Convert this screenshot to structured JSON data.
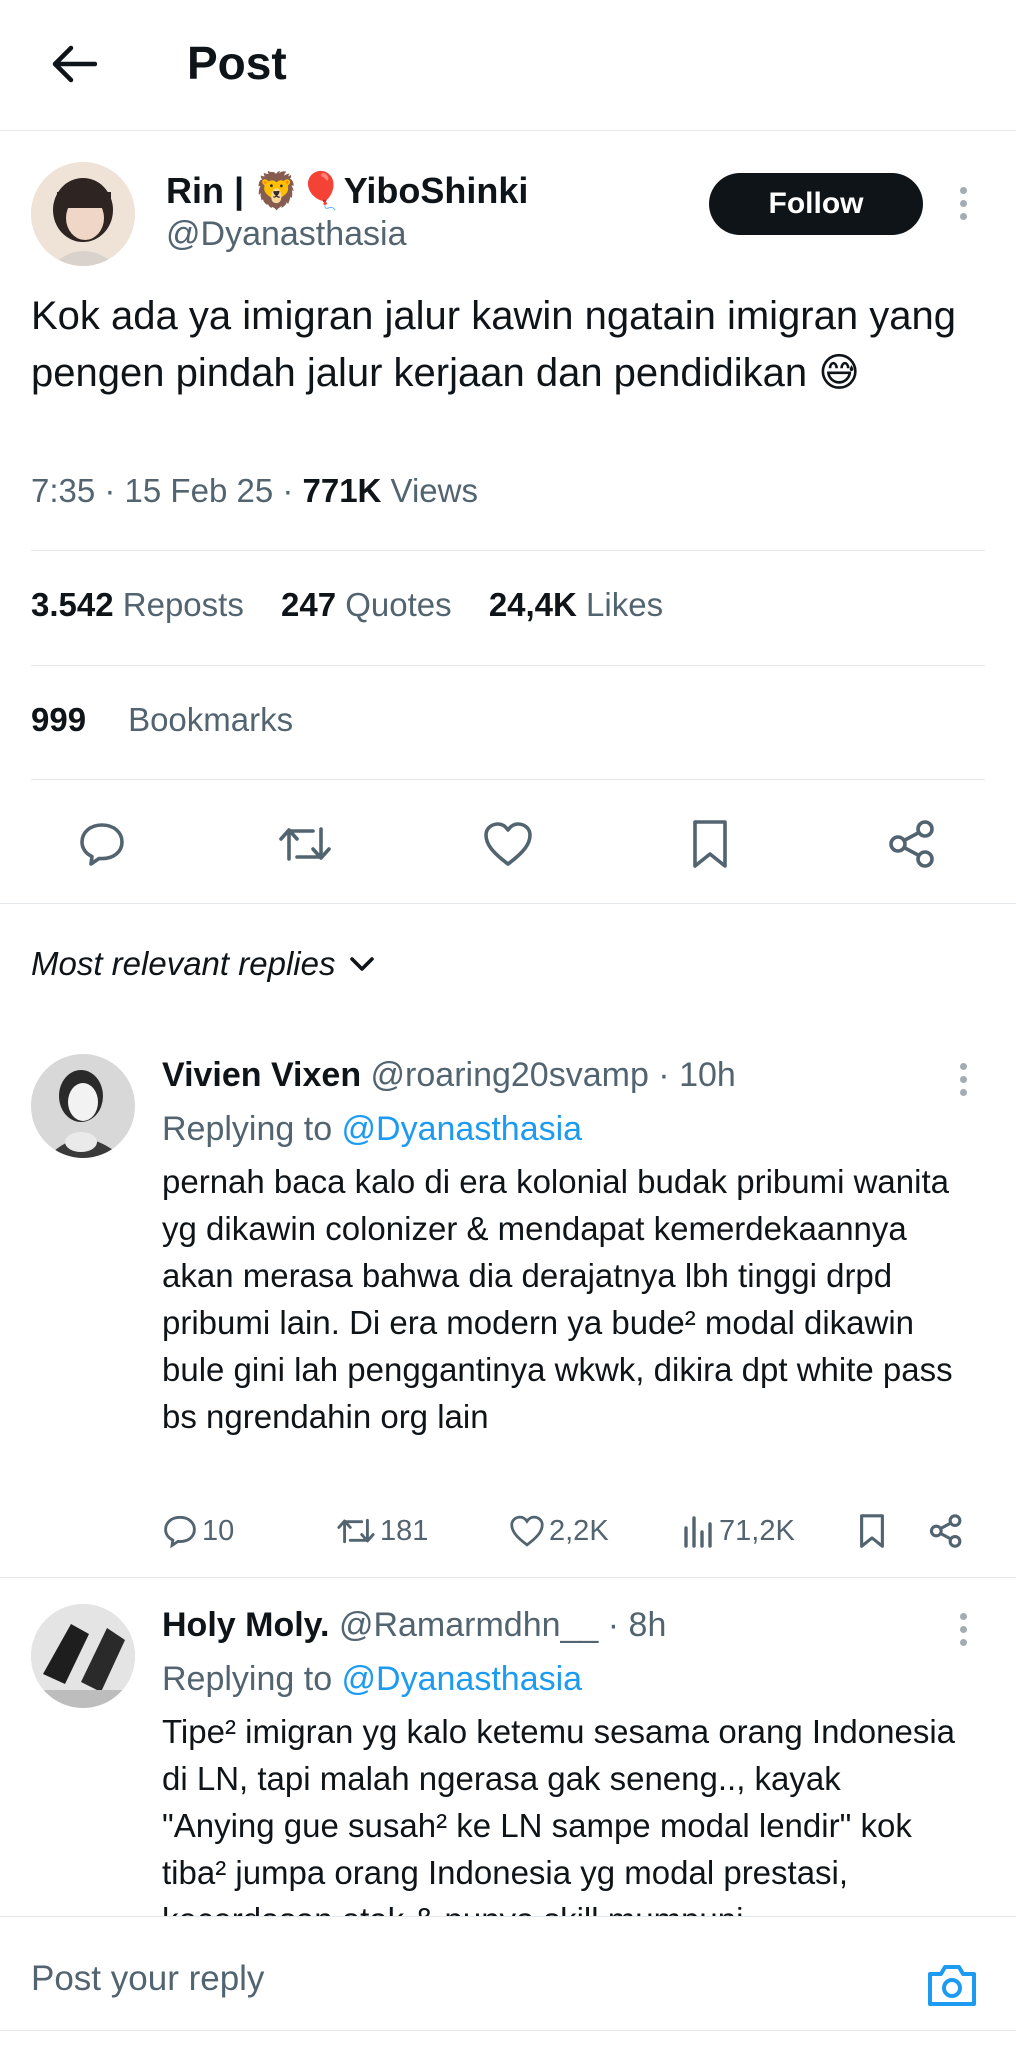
{
  "header": {
    "title": "Post"
  },
  "post": {
    "author_name": "Rin | 🦁🎈YiboShinki",
    "author_handle": "@Dyanasthasia",
    "follow_label": "Follow",
    "text": "Kok ada ya imigran jalur kawin ngatain imigran yang pengen pindah jalur kerjaan dan pendidikan 😅",
    "time": "7:35 · 15 Feb 25 · ",
    "views_count": "771K",
    "views_label": " Views",
    "reposts_count": "3.542",
    "reposts_label": " Reposts",
    "quotes_count": "247",
    "quotes_label": " Quotes",
    "likes_count": "24,4K",
    "likes_label": " Likes",
    "bookmarks_count": "999",
    "bookmarks_label": "Bookmarks"
  },
  "sort": {
    "label": "Most relevant replies"
  },
  "replies": [
    {
      "name": "Vivien Vixen",
      "handle_time": " @roaring20svamp · 10h",
      "replying_prefix": "Replying to ",
      "replying_handle": "@Dyanasthasia",
      "text": "pernah baca kalo di era kolonial budak pribumi wanita yg dikawin colonizer & mendapat kemerdekaannya akan merasa bahwa dia derajatnya lbh tinggi drpd pribumi lain. Di era modern ya bude² modal dikawin bule gini lah penggantinya wkwk, dikira dpt white pass bs ngrendahin org lain",
      "replies": "10",
      "reposts": "181",
      "likes": "2,2K",
      "views": "71,2K"
    },
    {
      "name": "Holy Moly.",
      "handle_time": " @Ramarmdhn__ · 8h",
      "replying_prefix": "Replying to ",
      "replying_handle": "@Dyanasthasia",
      "text": "Tipe² imigran yg kalo ketemu sesama orang Indonesia di LN, tapi malah ngerasa gak seneng.., kayak \"Anying gue susah² ke LN sampe modal lendir\" kok tiba² jumpa orang Indonesia yg modal prestasi, kecerdasan otak & punya skill mumpuni"
    }
  ],
  "reply_bar": {
    "placeholder": "Post your reply"
  },
  "colors": {
    "accent": "#1d9bf0",
    "text": "#0f1419",
    "muted": "#536471",
    "divider": "#e5e8eb"
  }
}
